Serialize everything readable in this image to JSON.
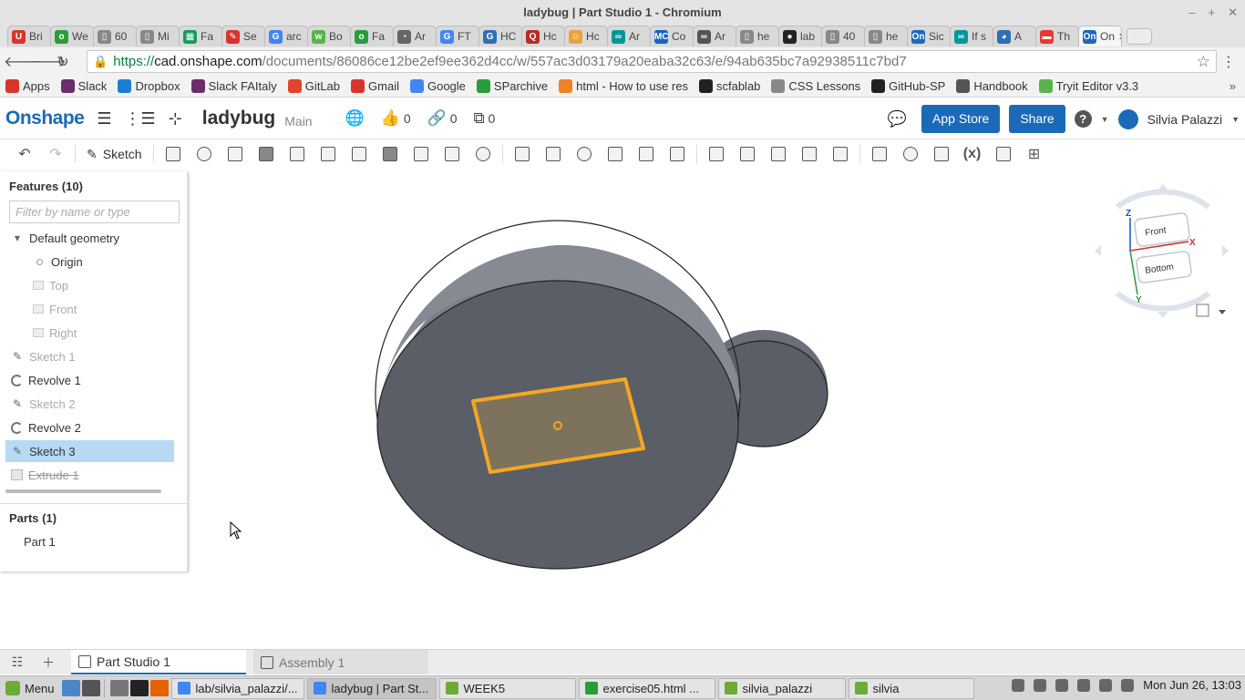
{
  "window": {
    "title": "ladybug | Part Studio 1 - Chromium"
  },
  "browser_tabs": [
    {
      "label": "Bri",
      "icon_color": "#d9342b",
      "icon_text": "U"
    },
    {
      "label": "We",
      "icon_color": "#2a9d38",
      "icon_text": "o"
    },
    {
      "label": "60",
      "icon_color": "#888888",
      "icon_text": "▯"
    },
    {
      "label": "Mi",
      "icon_color": "#888888",
      "icon_text": "▯"
    },
    {
      "label": "Fa",
      "icon_color": "#0f9d58",
      "icon_text": "▦"
    },
    {
      "label": "Se",
      "icon_color": "#d9342b",
      "icon_text": "✎"
    },
    {
      "label": "arc",
      "icon_color": "#4285f4",
      "icon_text": "G"
    },
    {
      "label": "Bo",
      "icon_color": "#5ab34a",
      "icon_text": "w"
    },
    {
      "label": "Fa",
      "icon_color": "#2a9d38",
      "icon_text": "o"
    },
    {
      "label": "Ar",
      "icon_color": "#666666",
      "icon_text": "◔"
    },
    {
      "label": "FT",
      "icon_color": "#4285f4",
      "icon_text": "G"
    },
    {
      "label": "HC",
      "icon_color": "#2c6fb3",
      "icon_text": "G"
    },
    {
      "label": "Hc",
      "icon_color": "#b92b27",
      "icon_text": "Q"
    },
    {
      "label": "Hc",
      "icon_color": "#e8a33a",
      "icon_text": "☺"
    },
    {
      "label": "Ar",
      "icon_color": "#00979c",
      "icon_text": "∞"
    },
    {
      "label": "Co",
      "icon_color": "#1565c0",
      "icon_text": "MC"
    },
    {
      "label": "Ar",
      "icon_color": "#555555",
      "icon_text": "∞"
    },
    {
      "label": "he",
      "icon_color": "#888888",
      "icon_text": "▯"
    },
    {
      "label": "lab",
      "icon_color": "#222222",
      "icon_text": "●"
    },
    {
      "label": "40",
      "icon_color": "#888888",
      "icon_text": "▯"
    },
    {
      "label": "he",
      "icon_color": "#888888",
      "icon_text": "▯"
    },
    {
      "label": "Sic",
      "icon_color": "#1b6ab7",
      "icon_text": "On"
    },
    {
      "label": "If s",
      "icon_color": "#00979c",
      "icon_text": "∞"
    },
    {
      "label": "A",
      "icon_color": "#2c6fb3",
      "icon_text": "◕"
    },
    {
      "label": "Th",
      "icon_color": "#e53935",
      "icon_text": "▬"
    },
    {
      "label": "On",
      "icon_color": "#1b6ab7",
      "icon_text": "On",
      "active": true
    }
  ],
  "address_bar": {
    "scheme": "https://",
    "host": "cad.onshape.com",
    "path": "/documents/86086ce12be2ef9ee362d4cc/w/557ac3d03179a20eaba32c63/e/94ab635bc7a92938511c7bd7"
  },
  "bookmarks": [
    {
      "label": "Apps",
      "icon": "apps-grid-icon",
      "color": "#d9342b"
    },
    {
      "label": "Slack",
      "icon": "slack-icon",
      "color": "#6b2d6b"
    },
    {
      "label": "Dropbox",
      "icon": "dropbox-icon",
      "color": "#1b7fd1"
    },
    {
      "label": "Slack FAItaly",
      "icon": "slack-icon",
      "color": "#6b2d6b"
    },
    {
      "label": "GitLab",
      "icon": "gitlab-icon",
      "color": "#e2432a"
    },
    {
      "label": "Gmail",
      "icon": "gmail-icon",
      "color": "#d9342b"
    },
    {
      "label": "Google",
      "icon": "google-icon",
      "color": "#4285f4"
    },
    {
      "label": "SParchive",
      "icon": "sparchive-icon",
      "color": "#2a9d38"
    },
    {
      "label": "html - How to use res",
      "icon": "stackoverflow-icon",
      "color": "#f48024"
    },
    {
      "label": "scfablab",
      "icon": "github-icon",
      "color": "#222222"
    },
    {
      "label": "CSS Lessons",
      "icon": "page-icon",
      "color": "#888888"
    },
    {
      "label": "GitHub-SP",
      "icon": "github-icon",
      "color": "#222222"
    },
    {
      "label": "Handbook",
      "icon": "book-icon",
      "color": "#555555"
    },
    {
      "label": "Tryit Editor v3.3",
      "icon": "w3schools-icon",
      "color": "#5ab34a"
    }
  ],
  "onshape_header": {
    "logo": "Onshape",
    "doc_title": "ladybug",
    "branch": "Main",
    "likes": "0",
    "links": "0",
    "copies": "0",
    "app_store_label": "App Store",
    "share_label": "Share",
    "help_label": "?",
    "user_name": "Silvia Palazzi"
  },
  "toolbar": {
    "sketch_label": "Sketch",
    "tools": [
      "extrude-icon",
      "revolve-icon",
      "sweep-icon",
      "loft-icon",
      "thicken-icon",
      "fillet-icon",
      "chamfer-icon",
      "draft-icon",
      "rib-icon",
      "shell-icon",
      "hole-icon",
      "pattern-icon",
      "mirror-icon",
      "boolean-icon",
      "split-icon",
      "transform-icon",
      "delete-part-icon",
      "modify-fillet-icon",
      "delete-face-icon",
      "move-face-icon",
      "replace-face-icon",
      "offset-surface-icon",
      "plane-icon",
      "helix-icon",
      "mate-connector-icon",
      "variable-icon",
      "plugin-icon",
      "add-custom-icon"
    ],
    "variable_label": "(x)"
  },
  "feature_panel": {
    "title": "Features (10)",
    "filter_placeholder": "Filter by name or type",
    "items": [
      {
        "label": "Default geometry",
        "type": "group",
        "state": "normal"
      },
      {
        "label": "Origin",
        "type": "origin",
        "state": "normal"
      },
      {
        "label": "Top",
        "type": "plane",
        "state": "hidden"
      },
      {
        "label": "Front",
        "type": "plane",
        "state": "hidden"
      },
      {
        "label": "Right",
        "type": "plane",
        "state": "hidden"
      },
      {
        "label": "Sketch 1",
        "type": "sketch",
        "state": "hidden"
      },
      {
        "label": "Revolve 1",
        "type": "revolve",
        "state": "normal"
      },
      {
        "label": "Sketch 2",
        "type": "sketch",
        "state": "hidden"
      },
      {
        "label": "Revolve 2",
        "type": "revolve",
        "state": "normal"
      },
      {
        "label": "Sketch 3",
        "type": "sketch",
        "state": "selected"
      },
      {
        "label": "Extrude 1",
        "type": "extrude",
        "state": "suppressed"
      }
    ],
    "parts_title": "Parts (1)",
    "parts": [
      "Part 1"
    ]
  },
  "viewcube": {
    "front_label": "Front",
    "bottom_label": "Bottom",
    "axis_z": "Z",
    "axis_x": "X",
    "axis_y": "Y"
  },
  "bottom_tabs": [
    {
      "label": "Part Studio 1",
      "active": true
    },
    {
      "label": "Assembly 1",
      "active": false
    }
  ],
  "taskbar": {
    "menu_label": "Menu",
    "windows": [
      {
        "label": "lab/silvia_palazzi/...",
        "icon_color": "#4285f4"
      },
      {
        "label": "ladybug | Part St...",
        "icon_color": "#4285f4",
        "active": true
      },
      {
        "label": "WEEK5",
        "icon_color": "#6cab36"
      },
      {
        "label": "exercise05.html ...",
        "icon_color": "#2a9d38"
      },
      {
        "label": "silvia_palazzi",
        "icon_color": "#6cab36"
      },
      {
        "label": "silvia",
        "icon_color": "#6cab36"
      }
    ],
    "clock": "Mon Jun 26, 13:03"
  },
  "colors": {
    "onshape_blue": "#1b6ab7",
    "selection_orange": "#f5a623",
    "part_gray": "#5a5e66",
    "selected_row": "#b6d9f4"
  }
}
